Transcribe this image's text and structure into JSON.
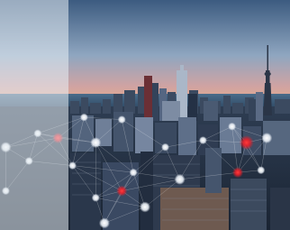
{
  "image": {
    "subject": "city-skyline-network",
    "colors": {
      "sky_top": "#3f5f86",
      "sky_mid": "#8aa3bf",
      "sky_horizon": "#d9a59b",
      "water": "#3a5873",
      "buildings_dark": "#243247",
      "buildings_mid": "#3d4d63",
      "node_white": "#e8eef5",
      "node_red": "#e8202a",
      "overlay": "#e8eef4"
    },
    "network": {
      "white_nodes": [
        [
          0.02,
          0.64
        ],
        [
          0.13,
          0.58
        ],
        [
          0.29,
          0.51
        ],
        [
          0.33,
          0.62
        ],
        [
          0.42,
          0.52
        ],
        [
          0.46,
          0.75
        ],
        [
          0.5,
          0.9
        ],
        [
          0.57,
          0.64
        ],
        [
          0.7,
          0.61
        ],
        [
          0.92,
          0.6
        ],
        [
          0.9,
          0.74
        ],
        [
          0.33,
          0.86
        ],
        [
          0.36,
          0.97
        ],
        [
          0.02,
          0.83
        ],
        [
          0.1,
          0.7
        ],
        [
          0.62,
          0.78
        ],
        [
          0.8,
          0.55
        ],
        [
          0.25,
          0.72
        ]
      ],
      "red_nodes": [
        [
          0.2,
          0.6
        ],
        [
          0.85,
          0.62
        ],
        [
          0.42,
          0.83
        ],
        [
          0.82,
          0.75
        ]
      ]
    }
  }
}
